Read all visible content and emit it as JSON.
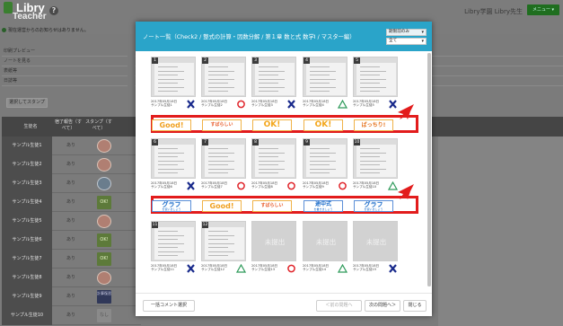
{
  "app": {
    "logo_line1": "Libry",
    "logo_line2": "Teacher",
    "user_name": "Libry学園 Libry先生",
    "menu_label": "メニュー ▾",
    "notice": "現在運営からのお知らせはありません。"
  },
  "left_links": [
    "印刷プレビュー",
    "ノートを見る",
    "表紙等",
    "日誌等"
  ],
  "stamp_button": "選択してスタンプ",
  "grid": {
    "col_name": "生徒名",
    "col_submitted": "宿了報告（すべて）",
    "col_stamp": "スタンプ（すべて）"
  },
  "students": [
    {
      "name": "サンプル生徒1",
      "status": "あり",
      "stamp": "badge"
    },
    {
      "name": "サンプル生徒2",
      "status": "あり",
      "stamp": "badge"
    },
    {
      "name": "サンプル生徒3",
      "status": "あり",
      "stamp": "blue"
    },
    {
      "name": "サンプル生徒4",
      "status": "あり",
      "stamp": "ok",
      "stamp_text": "OK!"
    },
    {
      "name": "サンプル生徒5",
      "status": "あり",
      "stamp": "badge"
    },
    {
      "name": "サンプル生徒6",
      "status": "あり",
      "stamp": "ok",
      "stamp_text": "OK!"
    },
    {
      "name": "サンプル生徒7",
      "status": "あり",
      "stamp": "ok",
      "stamp_text": "OK!"
    },
    {
      "name": "サンプル生徒8",
      "status": "あり",
      "stamp": "badge"
    },
    {
      "name": "サンプル生徒9",
      "status": "あり",
      "stamp": "navy",
      "stamp_text": "計算復習"
    },
    {
      "name": "サンプル生徒10",
      "status": "あり",
      "stamp": "gray",
      "stamp_text": "なし"
    }
  ],
  "modal": {
    "title": "ノート一覧（Check2 / 整式の計算・因数分解 / 第１章 数と式 数学Ⅰ / マスター編）",
    "filter_select": "期限前のみ",
    "all_select": "全て",
    "missing_label": "未提出",
    "bulk_comment": "一括コメント選択",
    "prev_question": "＜前の問題へ",
    "next_question": "次の問題へ＞",
    "close": "閉じる"
  },
  "notes_row1": [
    {
      "num": "1",
      "date": "2017年05月18日",
      "student": "サンプル生徒1",
      "mark": "cross"
    },
    {
      "num": "2",
      "date": "2017年05月18日",
      "student": "サンプル生徒2",
      "mark": "circle"
    },
    {
      "num": "3",
      "date": "2017年05月18日",
      "student": "サンプル生徒3",
      "mark": "cross"
    },
    {
      "num": "4",
      "date": "2017年05月18日",
      "student": "サンプル生徒4",
      "mark": "triangle"
    },
    {
      "num": "5",
      "date": "2017年05月18日",
      "student": "サンプル生徒5",
      "mark": "cross"
    }
  ],
  "stamps_row1": [
    {
      "text": "Good!",
      "style": "good"
    },
    {
      "text": "すばらしい",
      "style": "subarashii"
    },
    {
      "text": "OK!",
      "style": "ok"
    },
    {
      "text": "OK!",
      "style": "ok"
    },
    {
      "text": "ばっちり!",
      "style": "bacchiri"
    }
  ],
  "notes_row2": [
    {
      "num": "6",
      "date": "2017年05月18日",
      "student": "サンプル生徒6",
      "mark": "cross"
    },
    {
      "num": "7",
      "date": "2017年05月18日",
      "student": "サンプル生徒7",
      "mark": "circle"
    },
    {
      "num": "8",
      "date": "2017年05月18日",
      "student": "サンプル生徒8",
      "mark": "circle"
    },
    {
      "num": "9",
      "date": "2017年05月18日",
      "student": "サンプル生徒9",
      "mark": "circle"
    },
    {
      "num": "10",
      "date": "2017年05月18日",
      "student": "サンプル生徒10",
      "mark": "triangle"
    }
  ],
  "stamps_row2": [
    {
      "text": "グラフ",
      "sub": "を使いましょう",
      "style": "graph"
    },
    {
      "text": "Good!",
      "style": "good"
    },
    {
      "text": "すばらしい",
      "style": "subarashii"
    },
    {
      "text": "途中式",
      "sub": "を書きましょう",
      "style": "tochu"
    },
    {
      "text": "グラフ",
      "sub": "を使いましょう",
      "style": "graph"
    }
  ],
  "notes_row3": [
    {
      "num": "11",
      "date": "2017年05月18日",
      "student": "サンプル生徒11",
      "mark": "cross",
      "missing": false
    },
    {
      "num": "12",
      "date": "2017年05月18日",
      "student": "サンプル生徒12",
      "mark": "triangle",
      "missing": false
    },
    {
      "num": "",
      "date": "2017年05月18日",
      "student": "サンプル生徒13",
      "mark": "circle",
      "missing": true
    },
    {
      "num": "",
      "date": "2017年05月18日",
      "student": "サンプル生徒14",
      "mark": "triangle",
      "missing": true
    },
    {
      "num": "",
      "date": "2017年05月18日",
      "student": "サンプル生徒15",
      "mark": "cross",
      "missing": true
    }
  ],
  "colors": {
    "header": "#2aa4c9",
    "highlight": "#e21c1c",
    "cross": "#1a2b8c",
    "circle": "#e0252b",
    "triangle": "#2e9a5a"
  }
}
